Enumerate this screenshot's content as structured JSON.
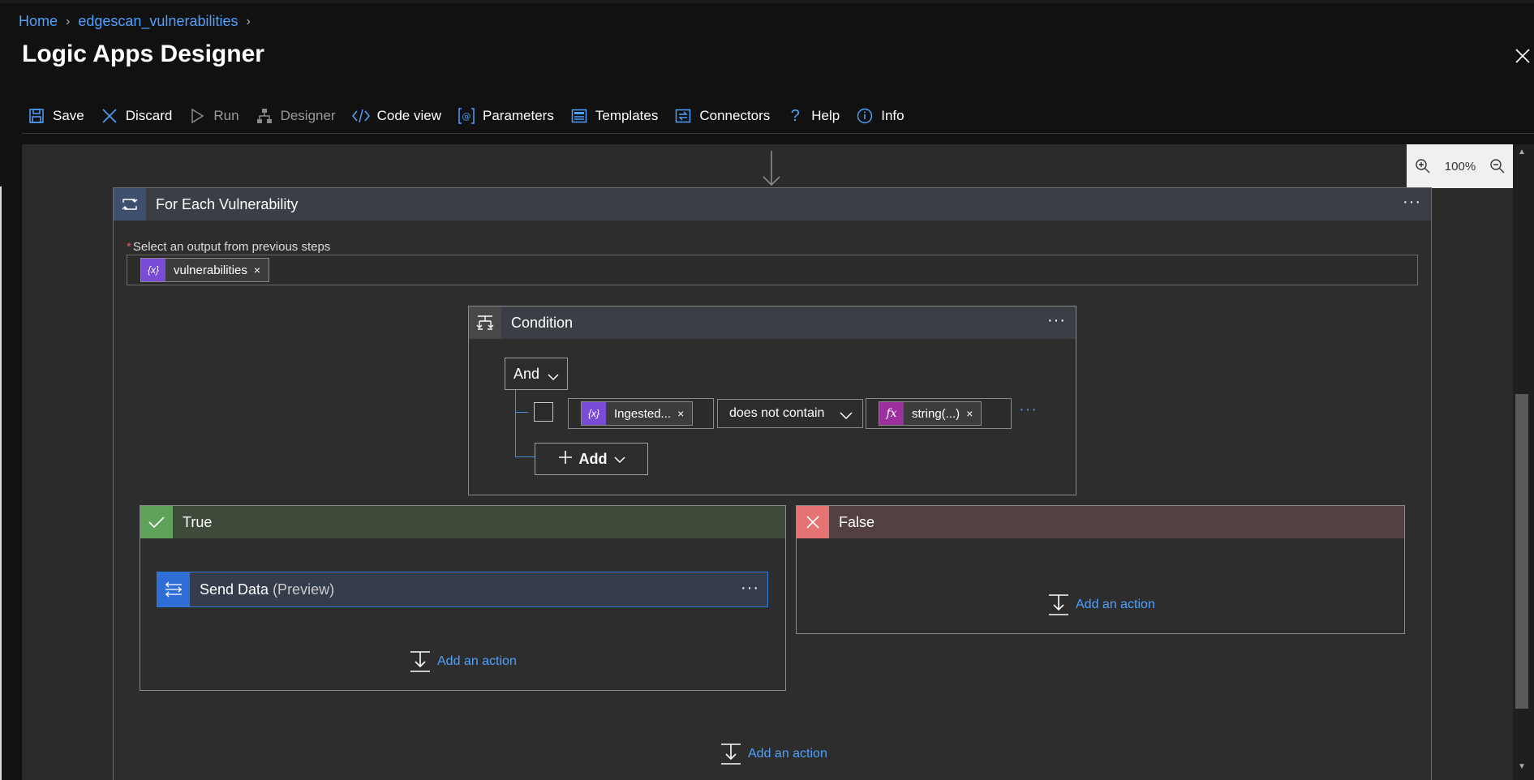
{
  "breadcrumb": {
    "home": "Home",
    "resource": "edgescan_vulnerabilities"
  },
  "header": {
    "title": "Logic Apps Designer"
  },
  "toolbar": {
    "save": "Save",
    "discard": "Discard",
    "run": "Run",
    "designer": "Designer",
    "code_view": "Code view",
    "parameters": "Parameters",
    "templates": "Templates",
    "connectors": "Connectors",
    "help": "Help",
    "info": "Info"
  },
  "zoom": {
    "level": "100%"
  },
  "foreach": {
    "title": "For Each Vulnerability",
    "required_label": "Select an output from previous steps",
    "token": "vulnerabilities"
  },
  "condition": {
    "title": "Condition",
    "group_operator": "And",
    "left_token": "Ingested...",
    "operator": "does not contain",
    "right_token": "string(...)",
    "add_label": "Add"
  },
  "true_branch": {
    "title": "True",
    "action_title": "Send Data",
    "action_suffix": "(Preview)",
    "add_action": "Add an action"
  },
  "false_branch": {
    "title": "False",
    "add_action": "Add an action"
  },
  "bottom": {
    "add_action": "Add an action"
  },
  "colors": {
    "accent": "#4ea1ff",
    "true_header": "#3e4a3a",
    "true_icon": "#5fa35a",
    "false_header": "#524140",
    "false_icon": "#e57373",
    "variable_token": "#7a4bd6",
    "expression_token": "#9b2f9d",
    "send_data_icon": "#2f6ed4"
  }
}
